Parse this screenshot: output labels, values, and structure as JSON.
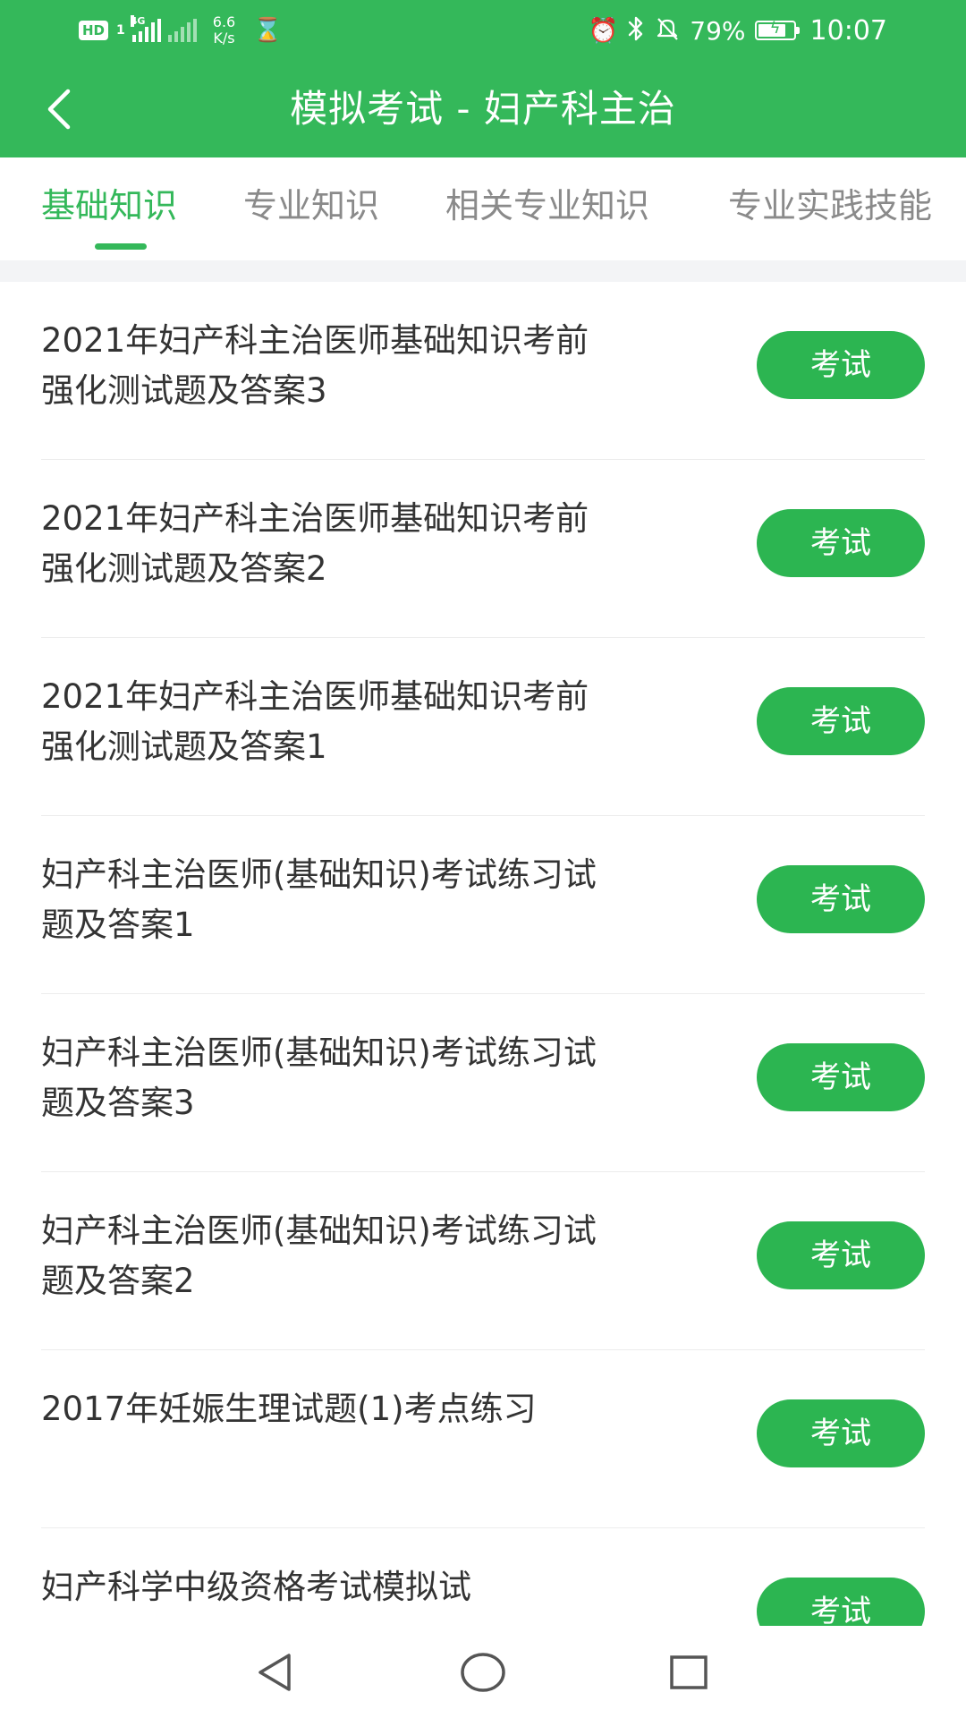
{
  "status_bar": {
    "hd_label": "HD",
    "hd_sub": "1",
    "network_label": "4G",
    "speed_value": "6.6",
    "speed_unit": "K/s",
    "battery_percent_text": "79%",
    "battery_level": 0.79,
    "time": "10:07",
    "icons": [
      "hd-icon",
      "signal-icon",
      "signal-icon",
      "hourglass-icon",
      "alarm-icon",
      "bluetooth-icon",
      "mute-icon",
      "battery-icon"
    ]
  },
  "header": {
    "title": "模拟考试 - 妇产科主治",
    "back_icon": "chevron-left-icon"
  },
  "tabs": [
    {
      "label": "基础知识",
      "active": true
    },
    {
      "label": "专业知识",
      "active": false
    },
    {
      "label": "相关专业知识",
      "active": false
    },
    {
      "label": "专业实践技能",
      "active": false
    }
  ],
  "exam_items": [
    {
      "title": "2021年妇产科主治医师基础知识考前强化测试题及答案3",
      "button_label": "考试"
    },
    {
      "title": "2021年妇产科主治医师基础知识考前强化测试题及答案2",
      "button_label": "考试"
    },
    {
      "title": "2021年妇产科主治医师基础知识考前强化测试题及答案1",
      "button_label": "考试"
    },
    {
      "title": "妇产科主治医师(基础知识)考试练习试题及答案1",
      "button_label": "考试"
    },
    {
      "title": "妇产科主治医师(基础知识)考试练习试题及答案3",
      "button_label": "考试"
    },
    {
      "title": "妇产科主治医师(基础知识)考试练习试题及答案2",
      "button_label": "考试"
    },
    {
      "title": "2017年妊娠生理试题(1)考点练习",
      "button_label": "考试"
    },
    {
      "title": "妇产科学中级资格考试模拟试",
      "button_label": "考试"
    }
  ],
  "nav_bar": {
    "icons": [
      "back-triangle-icon",
      "home-circle-icon",
      "recents-square-icon"
    ]
  },
  "colors": {
    "primary": "#34b85a",
    "button": "#2cb551",
    "tab_inactive": "#8a8a8a",
    "text": "#333333"
  }
}
